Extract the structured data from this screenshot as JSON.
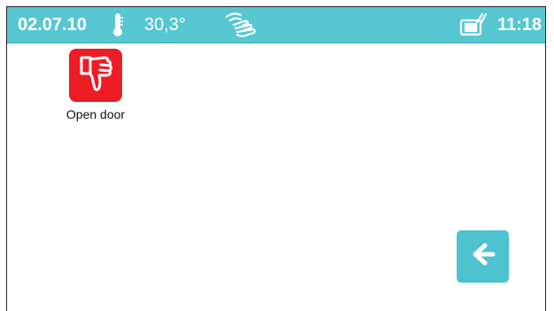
{
  "status_bar": {
    "date": "02.07.10",
    "temperature": "30,3°",
    "time": "11:18",
    "icons": [
      "thermometer-icon",
      "hand-swipe-icon",
      "message-icon"
    ]
  },
  "apps": [
    {
      "label": "Open door",
      "icon": "thumbs-down-icon",
      "color": "#ee1c24"
    }
  ],
  "back_button": {
    "icon": "back-arrow-icon",
    "color": "#4ec2cf"
  },
  "colors": {
    "status_bar_bg": "#57c7d2"
  }
}
